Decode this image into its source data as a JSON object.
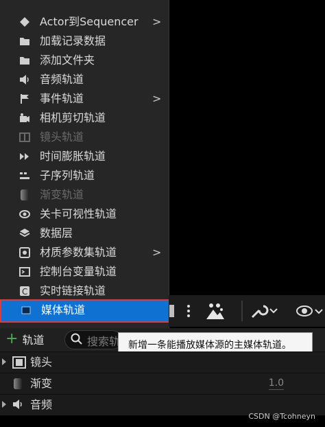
{
  "menu": {
    "items": [
      {
        "label": "Actor到Sequencer",
        "icon": "actor-icon",
        "submenu": true,
        "disabled": false
      },
      {
        "label": "加载记录数据",
        "icon": "folder-open-icon",
        "submenu": false,
        "disabled": false
      },
      {
        "label": "添加文件夹",
        "icon": "folder-icon",
        "submenu": false,
        "disabled": false
      },
      {
        "label": "音频轨道",
        "icon": "speaker-icon",
        "submenu": false,
        "disabled": false
      },
      {
        "label": "事件轨道",
        "icon": "flag-icon",
        "submenu": true,
        "disabled": false
      },
      {
        "label": "相机剪切轨道",
        "icon": "camera-cut-icon",
        "submenu": false,
        "disabled": false
      },
      {
        "label": "镜头轨道",
        "icon": "shot-icon",
        "submenu": false,
        "disabled": true
      },
      {
        "label": "时间膨胀轨道",
        "icon": "time-dilation-icon",
        "submenu": false,
        "disabled": false
      },
      {
        "label": "子序列轨道",
        "icon": "subsequence-icon",
        "submenu": false,
        "disabled": false
      },
      {
        "label": "渐变轨道",
        "icon": "fade-icon",
        "submenu": false,
        "disabled": true
      },
      {
        "label": "关卡可视性轨道",
        "icon": "eye-icon",
        "submenu": false,
        "disabled": false
      },
      {
        "label": "数据层",
        "icon": "layers-icon",
        "submenu": false,
        "disabled": false
      },
      {
        "label": "材质参数集轨道",
        "icon": "material-icon",
        "submenu": true,
        "disabled": false
      },
      {
        "label": "控制台变量轨道",
        "icon": "console-icon",
        "submenu": false,
        "disabled": false
      },
      {
        "label": "实时链接轨道",
        "icon": "livelink-icon",
        "submenu": false,
        "disabled": false
      }
    ],
    "selected": {
      "label": "媒体轨道",
      "icon": "media-icon"
    },
    "arrow": ">"
  },
  "toolbar": {
    "add_track_label": "轨道",
    "add_symbol": "+",
    "search_placeholder": "搜索轨"
  },
  "tooltip": {
    "text": "新增一条能播放媒体源的主媒体轨道。"
  },
  "tracks": [
    {
      "label": "镜头",
      "icon": "film-icon",
      "value": ""
    },
    {
      "label": "渐变",
      "icon": "fade-icon",
      "value": "1.0"
    },
    {
      "label": "音频",
      "icon": "speaker-icon",
      "value": ""
    }
  ],
  "watermark": "CSDN @Tcohneyn",
  "colors": {
    "selected_bg": "#0f72d2",
    "selected_outline": "#e53935",
    "menu_bg": "#262626"
  }
}
